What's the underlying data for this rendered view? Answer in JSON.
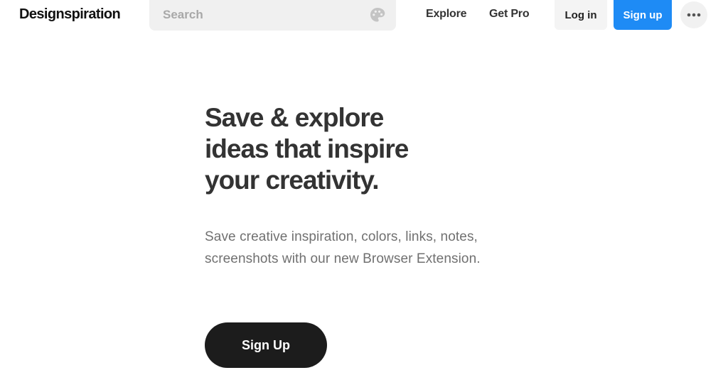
{
  "header": {
    "logo": "Designspiration",
    "search": {
      "placeholder": "Search",
      "value": "",
      "icon": "palette-icon"
    },
    "nav": {
      "explore": "Explore",
      "get_pro": "Get Pro"
    },
    "login_label": "Log in",
    "signup_label": "Sign up",
    "more_icon": "more-horizontal-icon"
  },
  "hero": {
    "headline_lines": [
      "Save & explore",
      "ideas that inspire",
      "your creativity."
    ],
    "subtext_lines": [
      "Save creative inspiration, colors, links, notes,",
      "screenshots with our new Browser Extension."
    ],
    "cta_label": "Sign Up"
  },
  "colors": {
    "accent": "#1e8bf5",
    "cta_background": "#1c1c1c",
    "headline": "#333333",
    "subtext": "#707070",
    "search_background": "#f0f0f0"
  }
}
